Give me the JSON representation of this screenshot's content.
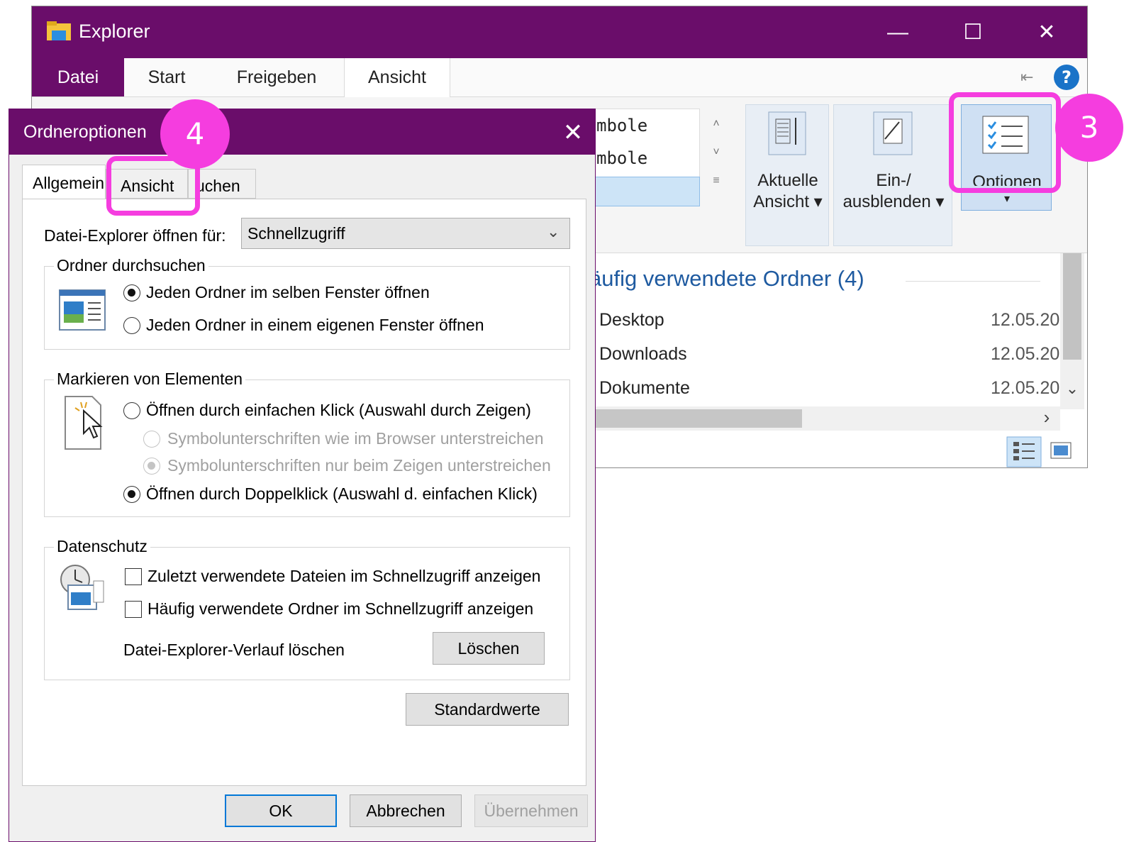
{
  "explorer": {
    "title": "Explorer",
    "window_controls": {
      "minimize": "—",
      "maximize": "☐",
      "close": "✕"
    },
    "ribbon_tabs": [
      "Datei",
      "Start",
      "Freigeben",
      "Ansicht"
    ],
    "gallery": {
      "row1": "mbole",
      "row2": "mbole"
    },
    "buttons": {
      "current_view": {
        "line1": "Aktuelle",
        "line2": "Ansicht ▾"
      },
      "show_hide": {
        "line1": "Ein-/",
        "line2": "ausblenden ▾"
      },
      "options": {
        "line1": "Optionen",
        "line2": "▾"
      }
    },
    "section_title": "äufig verwendete Ordner (4)",
    "rows": [
      {
        "name": "Desktop",
        "date": "12.05.20"
      },
      {
        "name": "Downloads",
        "date": "12.05.20"
      },
      {
        "name": "Dokumente",
        "date": "12.05.20"
      }
    ],
    "scroll_right": "›",
    "scroll_down": "⌄"
  },
  "markers": {
    "step3": "3",
    "step4": "4"
  },
  "dialog": {
    "title": "Ordneroptionen",
    "close": "✕",
    "tabs": [
      "Allgemein",
      "Ansicht",
      "Suchen"
    ],
    "tab_suchen_visible": "uchen",
    "open_for_label": "Datei-Explorer öffnen für:",
    "open_for_value": "Schnellzugriff",
    "browse_group": {
      "title": "Ordner durchsuchen",
      "opt_same": "Jeden Ordner im selben Fenster öffnen",
      "opt_new": "Jeden Ordner in einem eigenen Fenster öffnen"
    },
    "click_group": {
      "title": "Markieren von Elementen",
      "opt_single": "Öffnen durch einfachen Klick (Auswahl durch Zeigen)",
      "opt_underline_browser": "Symbolunterschriften wie im Browser unterstreichen",
      "opt_underline_hover": "Symbolunterschriften nur beim Zeigen unterstreichen",
      "opt_double": "Öffnen durch Doppelklick (Auswahl d. einfachen Klick)"
    },
    "privacy_group": {
      "title": "Datenschutz",
      "chk_recent_files": "Zuletzt verwendete Dateien im Schnellzugriff anzeigen",
      "chk_frequent_folders": "Häufig verwendete Ordner im Schnellzugriff anzeigen",
      "clear_label": "Datei-Explorer-Verlauf löschen",
      "clear_button": "Löschen"
    },
    "defaults_button": "Standardwerte",
    "ok": "OK",
    "cancel": "Abbrechen",
    "apply": "Übernehmen"
  }
}
